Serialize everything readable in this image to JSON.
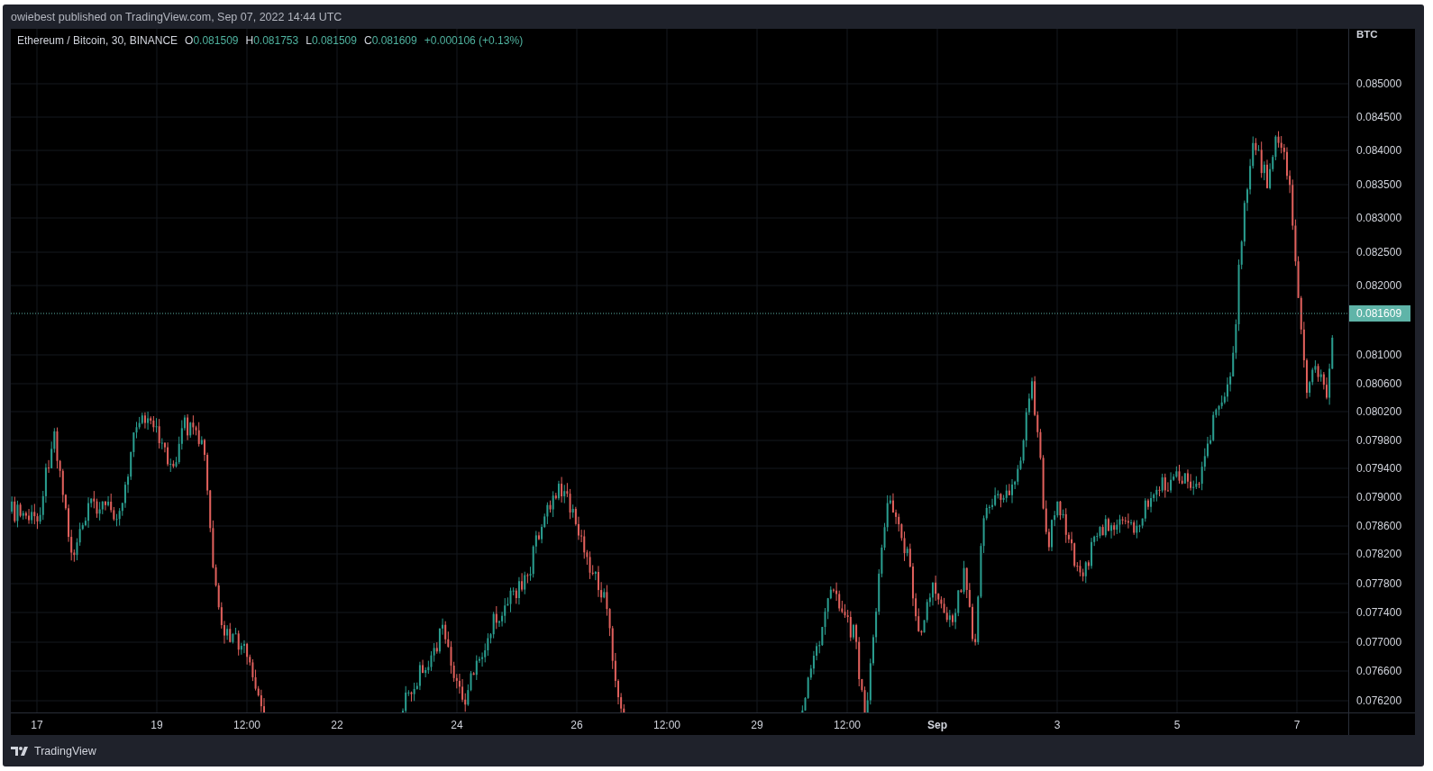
{
  "header": {
    "attribution": "owiebest published on TradingView.com, Sep 07, 2022 14:44 UTC"
  },
  "legend": {
    "symbol": "Ethereum / Bitcoin, 30, BINANCE",
    "ohlc": [
      {
        "label": "O",
        "value": "0.081509"
      },
      {
        "label": "H",
        "value": "0.081753"
      },
      {
        "label": "L",
        "value": "0.081509"
      },
      {
        "label": "C",
        "value": "0.081609"
      }
    ],
    "change": "+0.000106 (+0.13%)"
  },
  "price_axis": {
    "currency": "BTC",
    "labels": [
      "0.085000",
      "0.084500",
      "0.084000",
      "0.083500",
      "0.083000",
      "0.082500",
      "0.082000",
      "0.081000",
      "0.080600",
      "0.080200",
      "0.079800",
      "0.079400",
      "0.079000",
      "0.078600",
      "0.078200",
      "0.077800",
      "0.077400",
      "0.077000",
      "0.076600",
      "0.076200"
    ],
    "last_price": "0.081609"
  },
  "time_axis": {
    "labels": [
      {
        "text": "17",
        "emphasis": false
      },
      {
        "text": "19",
        "emphasis": false
      },
      {
        "text": "12:00",
        "emphasis": false
      },
      {
        "text": "22",
        "emphasis": false
      },
      {
        "text": "24",
        "emphasis": false
      },
      {
        "text": "26",
        "emphasis": false
      },
      {
        "text": "12:00",
        "emphasis": false
      },
      {
        "text": "29",
        "emphasis": false
      },
      {
        "text": "12:00",
        "emphasis": false
      },
      {
        "text": "Sep",
        "emphasis": true
      },
      {
        "text": "3",
        "emphasis": false
      },
      {
        "text": "5",
        "emphasis": false
      },
      {
        "text": "7",
        "emphasis": false
      }
    ]
  },
  "footer": {
    "brand": "TradingView"
  }
}
